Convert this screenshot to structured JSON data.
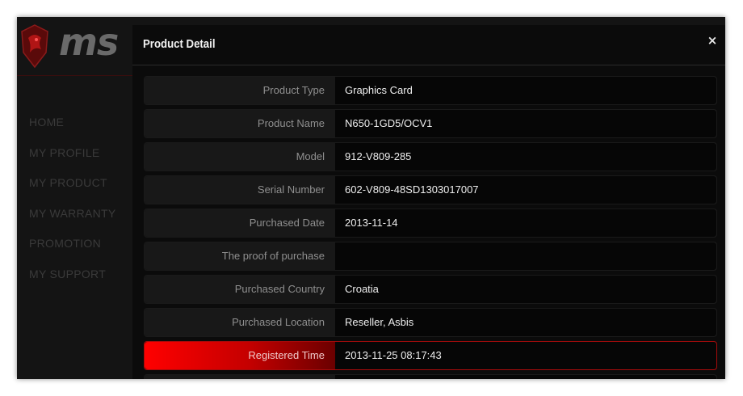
{
  "brand": {
    "logo_text": "ms"
  },
  "nav": {
    "items": [
      "HOME",
      "MY PROFILE",
      "MY PRODUCT",
      "MY WARRANTY",
      "PROMOTION",
      "MY SUPPORT"
    ]
  },
  "modal": {
    "title": "Product Detail",
    "close_symbol": "×",
    "rows": [
      {
        "label": "Product Type",
        "value": "Graphics Card"
      },
      {
        "label": "Product Name",
        "value": "N650-1GD5/OCV1"
      },
      {
        "label": "Model",
        "value": "912-V809-285"
      },
      {
        "label": "Serial Number",
        "value": "602-V809-48SD1303017007"
      },
      {
        "label": "Purchased Date",
        "value": "2013-11-14"
      },
      {
        "label": "The proof of purchase",
        "value": ""
      },
      {
        "label": "Purchased Country",
        "value": "Croatia"
      },
      {
        "label": "Purchased Location",
        "value": "Reseller, Asbis"
      },
      {
        "label": "Registered Time",
        "value": "2013-11-25 08:17:43"
      }
    ]
  },
  "colors": {
    "accent": "#ff0000",
    "background": "#0b0b0b"
  },
  "icons": {
    "logo": "dragon-shield-icon",
    "close": "close-icon"
  }
}
